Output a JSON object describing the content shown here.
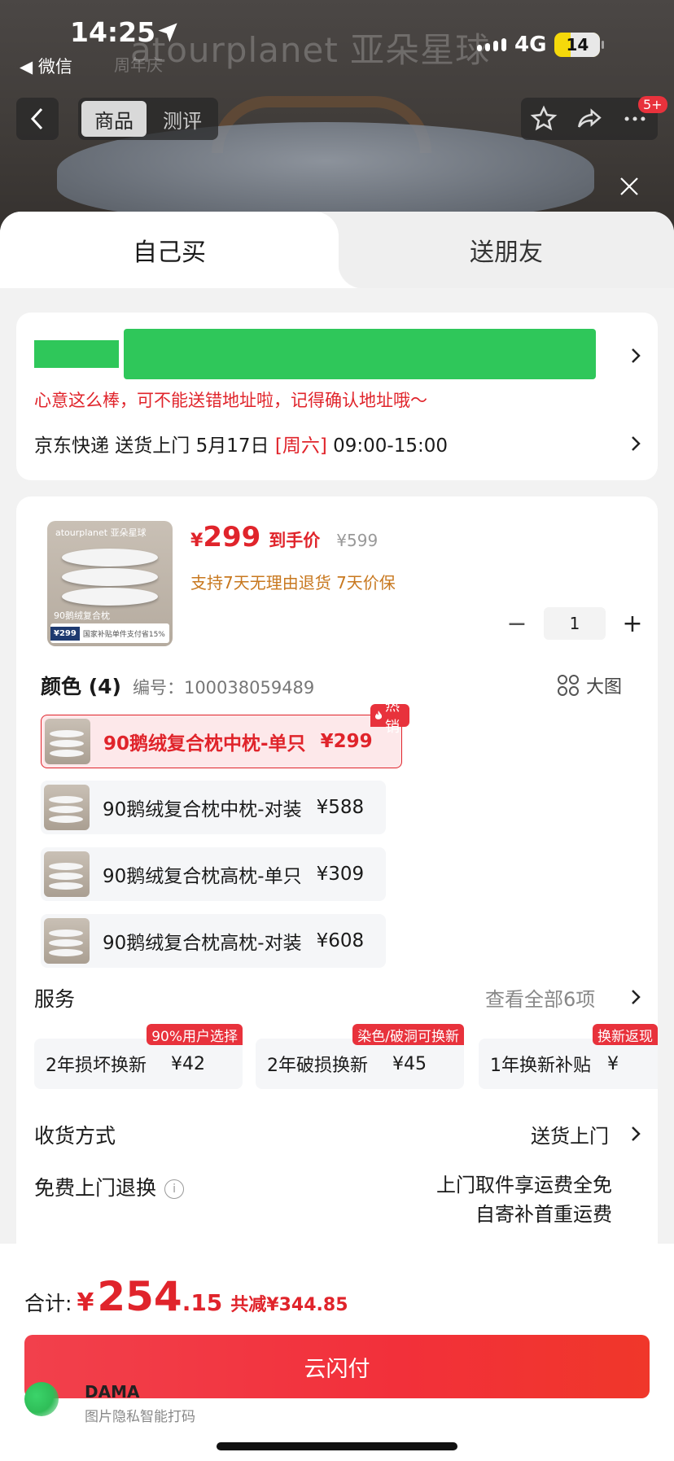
{
  "status_bar": {
    "time": "14:25",
    "back_app": "微信",
    "network": "4G",
    "battery": "14"
  },
  "hero": {
    "brand": "atourplanet 亚朵星球",
    "anniversary": "周年庆"
  },
  "nav": {
    "tabs": [
      "商品",
      "测评"
    ],
    "badge": "5+"
  },
  "sheet_tabs": {
    "self_buy": "自己买",
    "gift": "送朋友"
  },
  "address": {
    "warning": "心意这么棒，可不能送错地址啦，记得确认地址哦～",
    "ship_prefix": "京东快递 送货上门 5月17日 ",
    "ship_day": "[周六]",
    "ship_time": " 09:00-15:00"
  },
  "product": {
    "image_brand": "atourplanet 亚朵星球",
    "image_label": "90鹅绒复合枕",
    "image_price": "¥299",
    "image_bar": "国家补贴单件支付省15%",
    "currency": "¥",
    "price": "299",
    "price_tag": "到手价",
    "original_price": "¥599",
    "promise": "支持7天无理由退货  7天价保",
    "quantity": "1"
  },
  "color": {
    "title": "颜色 (4)",
    "sku": "编号：100038059489",
    "big_image": "大图",
    "hot_label": "热销",
    "variants": [
      {
        "name": "90鹅绒复合枕中枕-单只",
        "price": "¥299"
      },
      {
        "name": "90鹅绒复合枕中枕-对装",
        "price": "¥588"
      },
      {
        "name": "90鹅绒复合枕高枕-单只",
        "price": "¥309"
      },
      {
        "name": "90鹅绒复合枕高枕-对装",
        "price": "¥608"
      }
    ]
  },
  "services": {
    "title": "服务",
    "view_all": "查看全部6项",
    "items": [
      {
        "name": "2年损坏换新",
        "price": "¥42",
        "badge": "90%用户选择"
      },
      {
        "name": "2年破损换新",
        "price": "¥45",
        "badge": "染色/破洞可换新"
      },
      {
        "name": "1年换新补贴",
        "price": "¥",
        "badge": "换新返现"
      }
    ]
  },
  "delivery": {
    "label": "收货方式",
    "value": "送货上门"
  },
  "return_service": {
    "label": "免费上门退换",
    "line1": "上门取件享运费全免",
    "line2": "自寄补首重运费"
  },
  "footer": {
    "total_label": "合计:",
    "currency": "¥",
    "total_int": "254",
    "total_dec": ".15",
    "saving": "共减¥344.85",
    "pay_button": "云闪付",
    "watermark_title": "DAMA",
    "watermark_sub": "图片隐私智能打码"
  },
  "colors": {
    "accent": "#e0242b",
    "promise": "#c8781f",
    "redaction": "#2fc75a"
  }
}
